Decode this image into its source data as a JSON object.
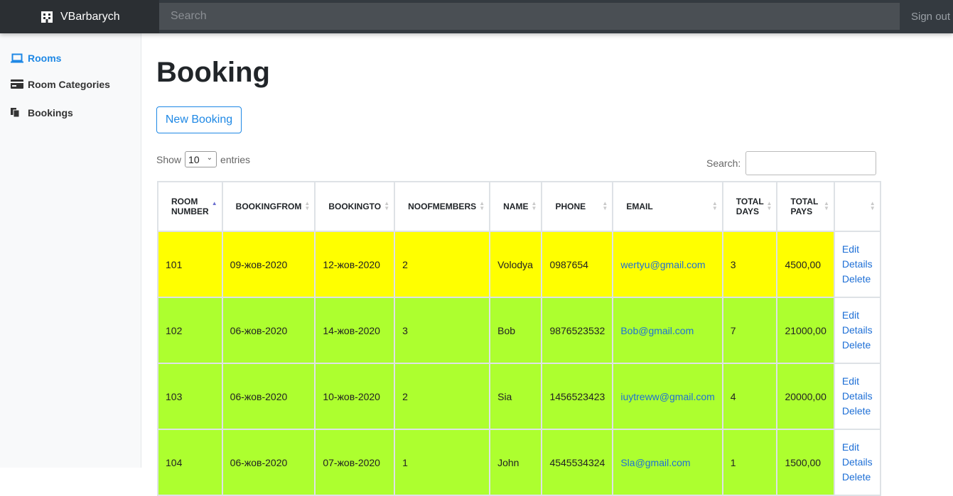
{
  "topbar": {
    "brand": "VBarbarych",
    "search_placeholder": "Search",
    "signout": "Sign out"
  },
  "sidebar": {
    "items": [
      {
        "label": "Rooms",
        "icon": "laptop-icon",
        "active": true
      },
      {
        "label": "Room Categories",
        "icon": "card-icon",
        "active": false
      },
      {
        "label": "Bookings",
        "icon": "copy-icon",
        "active": false
      }
    ]
  },
  "page": {
    "title": "Booking",
    "new_button": "New Booking",
    "show_label": "Show",
    "show_value": "10",
    "entries_label": "entries",
    "search_label": "Search:"
  },
  "table": {
    "headers": [
      "ROOM NUMBER",
      "BOOKINGFROM",
      "BOOKINGTO",
      "NOOFMEMBERS",
      "NAME",
      "PHONE",
      "EMAIL",
      "TOTAL DAYS",
      "TOTAL PAYS",
      ""
    ],
    "actions": [
      "Edit",
      "Details",
      "Delete"
    ],
    "rows": [
      {
        "room": "101",
        "from": "09-жов-2020",
        "to": "12-жов-2020",
        "members": "2",
        "name": "Volodya",
        "phone": "0987654",
        "email": "wertyu@gmail.com",
        "days": "3",
        "pays": "4500,00",
        "color": "#ffff00"
      },
      {
        "room": "102",
        "from": "06-жов-2020",
        "to": "14-жов-2020",
        "members": "3",
        "name": "Bob",
        "phone": "9876523532",
        "email": "Bob@gmail.com",
        "days": "7",
        "pays": "21000,00",
        "color": "#adff2f"
      },
      {
        "room": "103",
        "from": "06-жов-2020",
        "to": "10-жов-2020",
        "members": "2",
        "name": "Sia",
        "phone": "1456523423",
        "email": "iuytreww@gmail.com",
        "days": "4",
        "pays": "20000,00",
        "color": "#adff2f"
      },
      {
        "room": "104",
        "from": "06-жов-2020",
        "to": "07-жов-2020",
        "members": "1",
        "name": "John",
        "phone": "4545534324",
        "email": "Sla@gmail.com",
        "days": "1",
        "pays": "1500,00",
        "color": "#adff2f"
      }
    ]
  }
}
